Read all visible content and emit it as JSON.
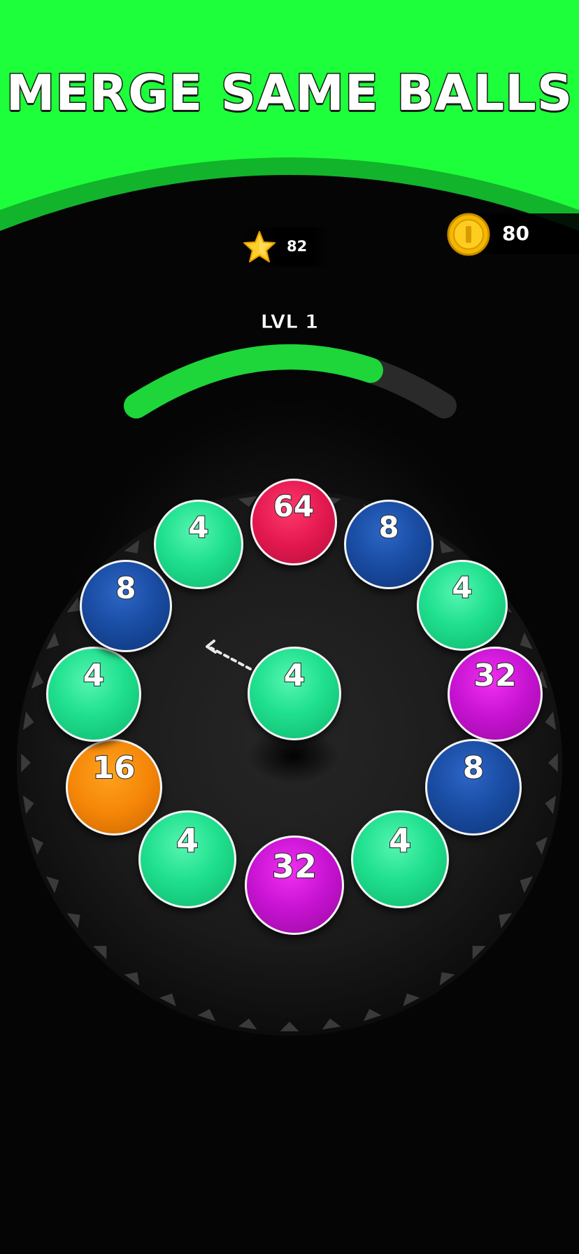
{
  "banner": {
    "title": "MERGE SAME BALLS",
    "colors": {
      "green": "#1eff3b",
      "green_dark": "#12b42b"
    }
  },
  "hud": {
    "star_icon": "star-icon",
    "stars": "82",
    "coin_icon": "coin-icon",
    "coins": "80"
  },
  "level": {
    "label": "LVL 1",
    "progress": 0.75,
    "progress_color": "#1ed53a",
    "track_color": "#2a2a2a"
  },
  "board": {
    "ring": [
      {
        "value": "64",
        "color": "red"
      },
      {
        "value": "8",
        "color": "blue"
      },
      {
        "value": "4",
        "color": "green"
      },
      {
        "value": "32",
        "color": "purple"
      },
      {
        "value": "8",
        "color": "blue"
      },
      {
        "value": "4",
        "color": "green"
      },
      {
        "value": "32",
        "color": "purple"
      },
      {
        "value": "4",
        "color": "green"
      },
      {
        "value": "16",
        "color": "orange"
      },
      {
        "value": "4",
        "color": "green"
      },
      {
        "value": "8",
        "color": "blue"
      },
      {
        "value": "4",
        "color": "green"
      }
    ],
    "shooter": {
      "value": "4",
      "color": "green"
    },
    "aim_icon": "dashed-arrow-icon"
  }
}
